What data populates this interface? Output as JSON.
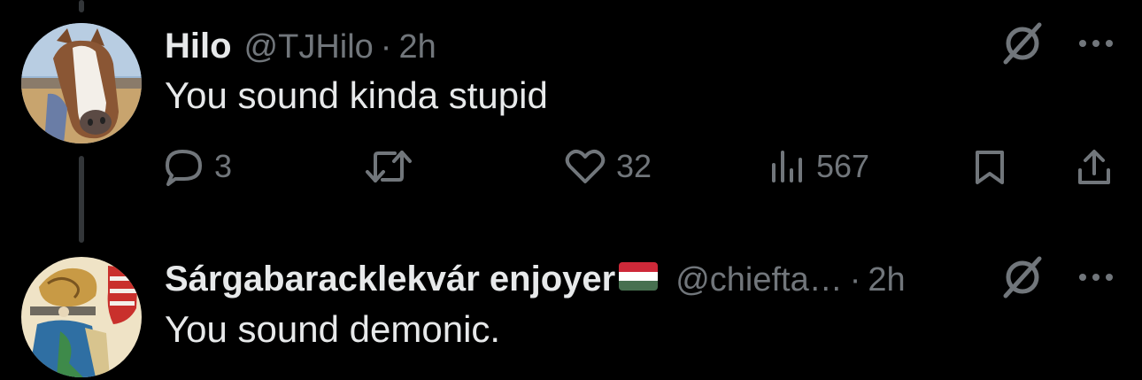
{
  "tweets": [
    {
      "name": "Hilo",
      "handle": "@TJHilo",
      "separator": "·",
      "time": "2h",
      "text": "You sound kinda stupid",
      "stats": {
        "replies": "3",
        "retweets": "",
        "likes": "32",
        "views": "567"
      },
      "avatar_icon": "horse-avatar"
    },
    {
      "name": "Sárgabaracklekvár enjoyer",
      "flag": "hungary-flag",
      "handle": "@chiefta…",
      "separator": "·",
      "time": "2h",
      "text": "You sound demonic.",
      "avatar_icon": "medieval-art-avatar"
    }
  ],
  "colors": {
    "background": "#000000",
    "primary_text": "#e7e9ea",
    "secondary_text": "#71767b",
    "thread_line": "#333639"
  }
}
